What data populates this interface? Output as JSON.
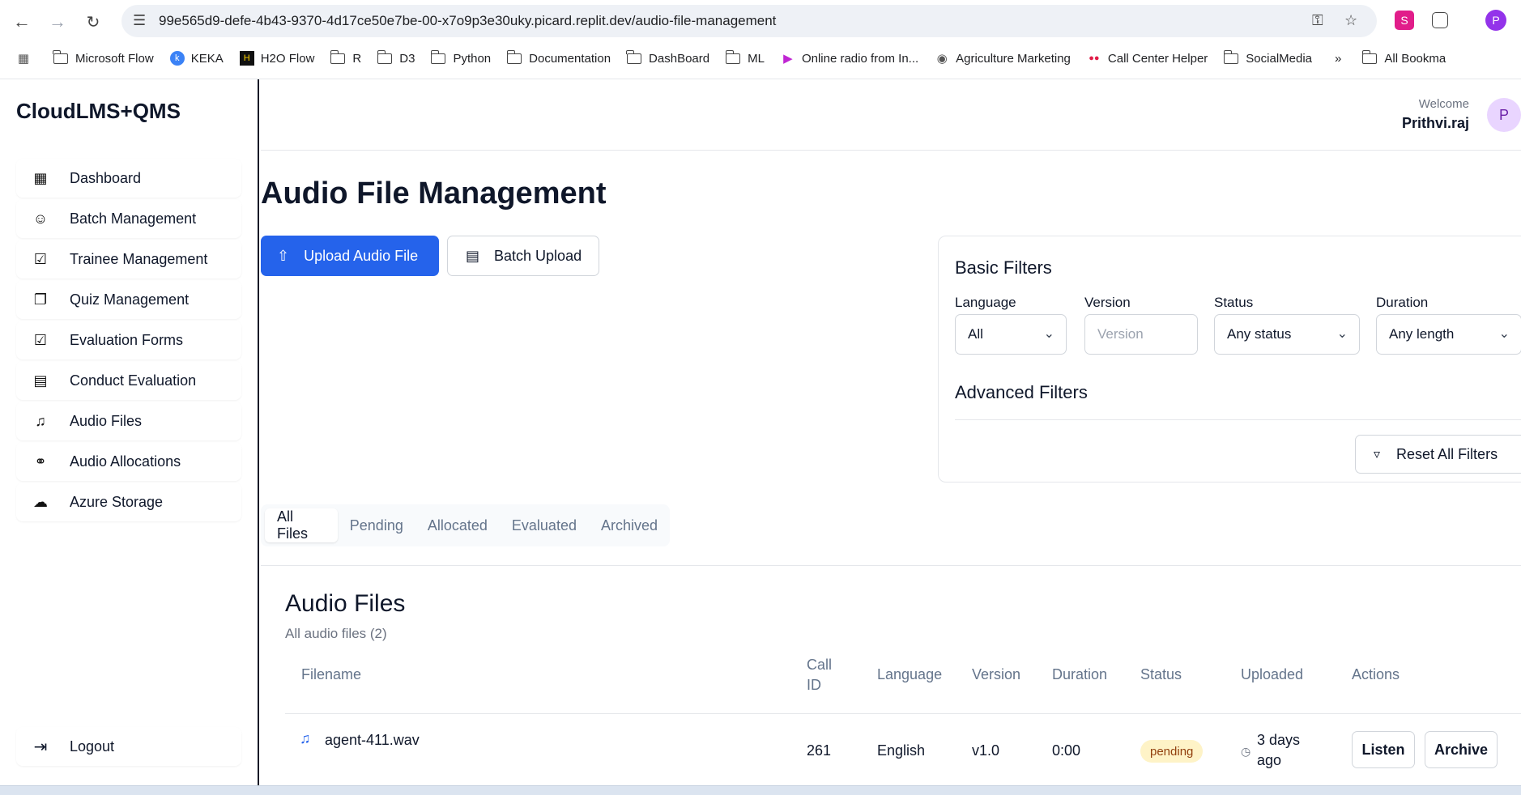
{
  "browser": {
    "url": "99e565d9-defe-4b43-9370-4d17ce50e7be-00-x7o9p3e30uky.picard.replit.dev/audio-file-management",
    "bookmarks": [
      {
        "label": "Microsoft Flow",
        "icon": "folder-icon"
      },
      {
        "label": "KEKA",
        "icon": "keka-icon"
      },
      {
        "label": "H2O Flow",
        "icon": "h2o-icon"
      },
      {
        "label": "R",
        "icon": "folder-icon"
      },
      {
        "label": "D3",
        "icon": "folder-icon"
      },
      {
        "label": "Python",
        "icon": "folder-icon"
      },
      {
        "label": "Documentation",
        "icon": "folder-icon"
      },
      {
        "label": "DashBoard",
        "icon": "folder-icon"
      },
      {
        "label": "ML",
        "icon": "folder-icon"
      },
      {
        "label": "Online radio from In...",
        "icon": "radio-icon"
      },
      {
        "label": "Agriculture Marketing",
        "icon": "globe-icon"
      },
      {
        "label": "Call Center Helper",
        "icon": "dots-icon"
      },
      {
        "label": "SocialMedia",
        "icon": "folder-icon"
      }
    ],
    "all_bookmarks": "All Bookma",
    "more": "»",
    "avatar_letter": "P"
  },
  "sidebar": {
    "brand": "CloudLMS+QMS",
    "items": [
      {
        "label": "Dashboard",
        "icon": "dashboard-icon"
      },
      {
        "label": "Batch Management",
        "icon": "users-icon"
      },
      {
        "label": "Trainee Management",
        "icon": "clipboard-icon"
      },
      {
        "label": "Quiz Management",
        "icon": "book-icon"
      },
      {
        "label": "Evaluation Forms",
        "icon": "checkbox-icon"
      },
      {
        "label": "Conduct Evaluation",
        "icon": "document-icon"
      },
      {
        "label": "Audio Files",
        "icon": "audio-file-icon"
      },
      {
        "label": "Audio Allocations",
        "icon": "headphones-icon"
      },
      {
        "label": "Azure Storage",
        "icon": "cloud-icon"
      }
    ],
    "logout": "Logout"
  },
  "header": {
    "welcome": "Welcome",
    "username": "Prithvi.raj",
    "avatar_letter": "P"
  },
  "page": {
    "title": "Audio File Management",
    "upload_button": "Upload Audio File",
    "batch_upload_button": "Batch Upload"
  },
  "filters": {
    "title": "Basic Filters",
    "language_label": "Language",
    "language_value": "All",
    "version_label": "Version",
    "version_placeholder": "Version",
    "status_label": "Status",
    "status_value": "Any status",
    "duration_label": "Duration",
    "duration_value": "Any length",
    "advanced_title": "Advanced Filters",
    "reset_button": "Reset All Filters"
  },
  "tabs": [
    {
      "label": "All Files",
      "active": true
    },
    {
      "label": "Pending",
      "active": false
    },
    {
      "label": "Allocated",
      "active": false
    },
    {
      "label": "Evaluated",
      "active": false
    },
    {
      "label": "Archived",
      "active": false
    }
  ],
  "files": {
    "title": "Audio Files",
    "subtitle": "All audio files (2)",
    "columns": {
      "filename": "Filename",
      "call_id_1": "Call",
      "call_id_2": "ID",
      "language": "Language",
      "version": "Version",
      "duration": "Duration",
      "status": "Status",
      "uploaded": "Uploaded",
      "actions": "Actions"
    },
    "rows": [
      {
        "filename": "agent-411.wav",
        "call_id": "261",
        "language": "English",
        "version": "v1.0",
        "duration": "0:00",
        "status": "pending",
        "uploaded_1": "3 days",
        "uploaded_2": "ago",
        "listen": "Listen",
        "archive": "Archive"
      }
    ]
  },
  "colors": {
    "primary": "#2563eb",
    "pending_badge_bg": "#fef3c7",
    "pending_badge_text": "#92400e"
  }
}
